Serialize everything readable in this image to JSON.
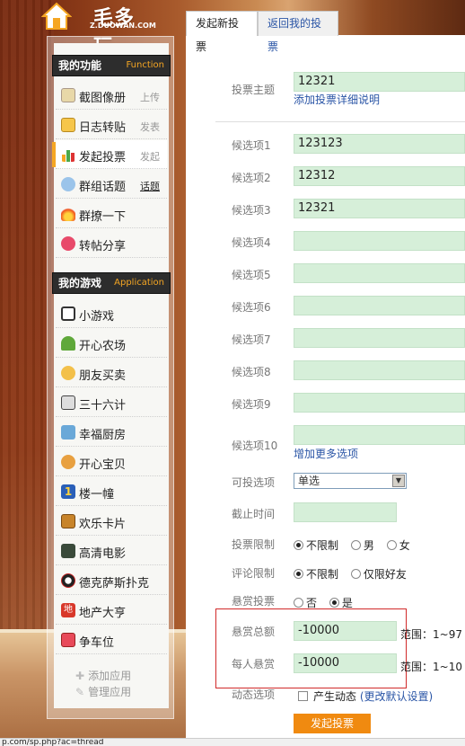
{
  "logo": {
    "text": "毛多玩",
    "sub": "Z.DUOWAN.COM"
  },
  "tabs": [
    {
      "label": "发起新投票"
    },
    {
      "label": "返回我的投票"
    }
  ],
  "sidebar": {
    "functions_header": {
      "title": "我的功能",
      "en": "Function"
    },
    "functions": [
      {
        "label": "截图像册",
        "action": "上传",
        "icon": "photo-album-icon"
      },
      {
        "label": "日志转贴",
        "action": "发表",
        "icon": "blog-icon"
      },
      {
        "label": "发起投票",
        "action": "发起",
        "icon": "poll-chart-icon"
      },
      {
        "label": "群组话题",
        "action": "话题",
        "icon": "group-icon"
      },
      {
        "label": "群撩一下",
        "action": "",
        "icon": "fire-icon"
      },
      {
        "label": "转帖分享",
        "action": "",
        "icon": "share-hearts-icon"
      }
    ],
    "games_header": {
      "title": "我的游戏",
      "en": "Application"
    },
    "games": [
      {
        "label": "小游戏",
        "icon": "cow-icon"
      },
      {
        "label": "开心农场",
        "icon": "sprout-icon"
      },
      {
        "label": "朋友买卖",
        "icon": "friends-icon"
      },
      {
        "label": "三十六计",
        "icon": "figure-icon"
      },
      {
        "label": "幸福厨房",
        "icon": "kitchen-icon"
      },
      {
        "label": "开心宝贝",
        "icon": "baby-icon"
      },
      {
        "label": "楼一幢",
        "icon": "number-one-icon"
      },
      {
        "label": "欢乐卡片",
        "icon": "card-icon"
      },
      {
        "label": "高清电影",
        "icon": "film-icon"
      },
      {
        "label": "德克萨斯扑克",
        "icon": "poker-icon"
      },
      {
        "label": "地产大亨",
        "icon": "estate-icon"
      },
      {
        "label": "争车位",
        "icon": "parking-icon"
      }
    ],
    "footer": [
      {
        "label": "添加应用",
        "glyph": "✚"
      },
      {
        "label": "管理应用",
        "glyph": "✎"
      }
    ]
  },
  "form": {
    "subject_label": "投票主题",
    "subject_value": "12321",
    "add_detail_link": "添加投票详细说明",
    "options": [
      {
        "label": "候选项1",
        "value": "123123"
      },
      {
        "label": "候选项2",
        "value": "12312"
      },
      {
        "label": "候选项3",
        "value": "12321"
      },
      {
        "label": "候选项4",
        "value": ""
      },
      {
        "label": "候选项5",
        "value": ""
      },
      {
        "label": "候选项6",
        "value": ""
      },
      {
        "label": "候选项7",
        "value": ""
      },
      {
        "label": "候选项8",
        "value": ""
      },
      {
        "label": "候选项9",
        "value": ""
      },
      {
        "label": "候选项10",
        "value": ""
      }
    ],
    "more_options_link": "增加更多选项",
    "choice_label": "可投选项",
    "choice_value": "单选",
    "deadline_label": "截止时间",
    "deadline_value": "",
    "limit_label": "投票限制",
    "limit_options": [
      "不限制",
      "男",
      "女"
    ],
    "comment_label": "评论限制",
    "comment_options": [
      "不限制",
      "仅限好友"
    ],
    "reward_label": "悬赏投票",
    "reward_options": [
      "否",
      "是"
    ],
    "total_label": "悬赏总额",
    "total_value": "-10000",
    "total_range": "范围：1~97",
    "per_label": "每人悬赏",
    "per_value": "-10000",
    "per_range": "范围：1~10",
    "dynamic_label": "动态选项",
    "dynamic_text": "产生动态",
    "dynamic_link": "(更改默认设置)",
    "submit_label": "发起投票"
  },
  "status": {
    "url": "p.com/sp.php?ac=thread"
  },
  "colors": {
    "accent": "#f08a10",
    "field_bg": "#d6efd9",
    "link": "#2a55a6",
    "highlight_box": "#d12a2a"
  }
}
